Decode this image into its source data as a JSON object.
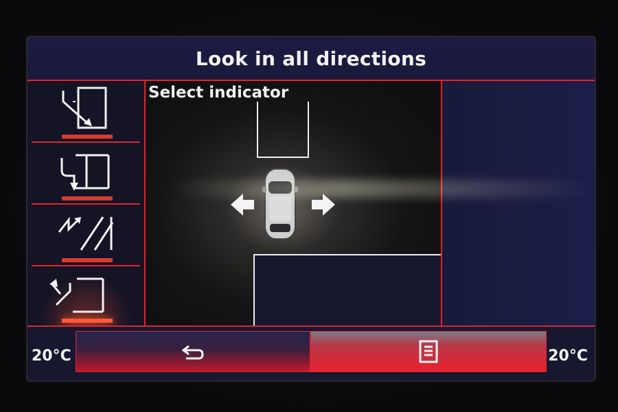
{
  "header": {
    "title": "Look in all directions"
  },
  "main": {
    "subtitle": "Select indicator"
  },
  "sidebar": {
    "items": [
      {
        "name": "parallel-parking-left"
      },
      {
        "name": "perpendicular-parking"
      },
      {
        "name": "angled-parking"
      },
      {
        "name": "parallel-parking-exit",
        "active": true
      }
    ]
  },
  "footer": {
    "temp_left": "20°C",
    "temp_right": "20°C",
    "back_icon": "back-arrow-icon",
    "menu_icon": "list-menu-icon"
  },
  "colors": {
    "accent": "#e0242c",
    "panel": "#1a1a3a",
    "text": "#f2f2f2"
  }
}
